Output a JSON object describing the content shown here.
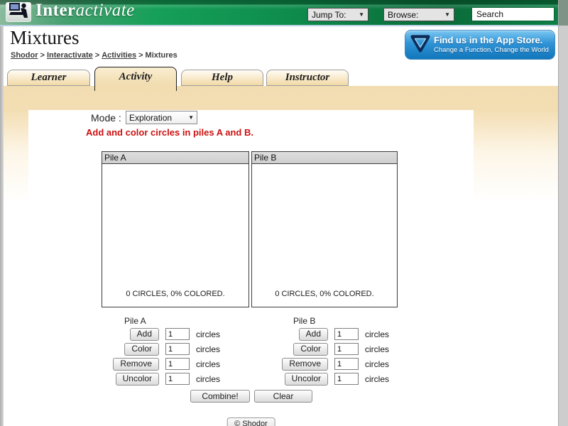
{
  "header": {
    "brand_bold": "Inter",
    "brand_italic": "activate",
    "jump_to": "Jump To:",
    "browse": "Browse:",
    "search_value": "Search"
  },
  "page": {
    "title": "Mixtures",
    "breadcrumb": {
      "sep": ">",
      "links": [
        "Shodor",
        "Interactivate",
        "Activities"
      ],
      "current": "Mixtures"
    },
    "app_badge": {
      "line1": "Find us in the App Store.",
      "line2": "Change a Function, Change the World"
    }
  },
  "tabs": [
    {
      "label": "Learner"
    },
    {
      "label": "Activity"
    },
    {
      "label": "Help"
    },
    {
      "label": "Instructor"
    }
  ],
  "activity": {
    "mode_label": "Mode :",
    "mode_value": "Exploration",
    "instruction": "Add and color circles in piles A and B.",
    "pile_a": {
      "title": "Pile A",
      "status": "0 CIRCLES, 0% COLORED."
    },
    "pile_b": {
      "title": "Pile B",
      "status": "0 CIRCLES, 0% COLORED."
    },
    "controls": {
      "pile_a_label": "Pile A",
      "pile_b_label": "Pile B",
      "actions": [
        "Add",
        "Color",
        "Remove",
        "Uncolor"
      ],
      "count_value": "1",
      "unit": "circles",
      "combine": "Combine!",
      "clear": "Clear"
    },
    "footer": "© Shodor"
  },
  "colors": {
    "header_green": "#0d7f46",
    "tan_band": "#f2ddb1",
    "instruction_red": "#cc1111",
    "badge_blue": "#2f93d6",
    "pile_header_gray": "#d5d5d5"
  }
}
